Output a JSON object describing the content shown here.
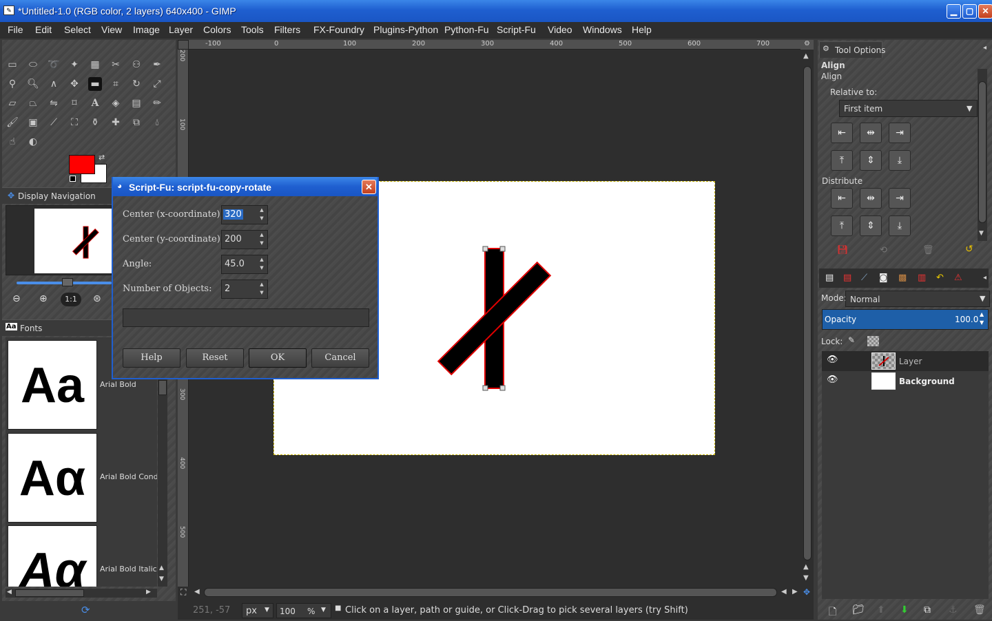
{
  "window": {
    "title": "*Untitled-1.0 (RGB color, 2 layers) 640x400 - GIMP",
    "min": "▁",
    "max": "▢",
    "close": "✕"
  },
  "menu": [
    "File",
    "Edit",
    "Select",
    "View",
    "Image",
    "Layer",
    "Colors",
    "Tools",
    "Filters",
    "FX-Foundry",
    "Plugins-Python",
    "Python-Fu",
    "Script-Fu",
    "Video",
    "Windows",
    "Help"
  ],
  "colors": {
    "fg": "#ff0000",
    "bg": "#ffffff",
    "accent": "#1f5fd0",
    "opacity_bar": "#1e5fa8"
  },
  "navigation": {
    "title": "Display Navigation"
  },
  "fonts": {
    "title": "Fonts",
    "items": [
      {
        "preview": "Aa",
        "name": "Arial Bold"
      },
      {
        "preview": "Aα",
        "name": "Arial Bold Conde"
      },
      {
        "preview": "Aα",
        "name": "Arial Bold Italic"
      }
    ]
  },
  "ruler_top": [
    "-100",
    "0",
    "100",
    "200",
    "300",
    "400",
    "500",
    "600",
    "700"
  ],
  "ruler_left": [
    "200",
    "100",
    "0",
    "100",
    "200",
    "300",
    "400",
    "500"
  ],
  "dialog": {
    "title": "Script-Fu: script-fu-copy-rotate",
    "fields": [
      {
        "label": "Center (x-coordinate):",
        "value": "320"
      },
      {
        "label": "Center (y-coordinate):",
        "value": "200"
      },
      {
        "label": "Angle:",
        "value": "45.0"
      },
      {
        "label": "Number of Objects:",
        "value": "2"
      }
    ],
    "buttons": {
      "help": "Help",
      "reset": "Reset",
      "ok": "OK",
      "cancel": "Cancel"
    }
  },
  "tool_options": {
    "tab": "Tool Options",
    "heading": "Align",
    "subheading": "Align",
    "relative_label": "Relative to:",
    "relative_value": "First item",
    "distribute_label": "Distribute"
  },
  "layers": {
    "mode_label": "Mode:",
    "mode_value": "Normal",
    "opacity_label": "Opacity",
    "opacity_value": "100.0",
    "opacity_level": 1.0,
    "lock_label": "Lock:",
    "items": [
      {
        "name": "Layer",
        "bold": false
      },
      {
        "name": "Background",
        "bold": true
      }
    ]
  },
  "status": {
    "coords": "251, -57",
    "unit": "px",
    "zoom": "100",
    "zoom_unit": "%",
    "message": "Click on a layer, path or guide, or Click-Drag to pick several layers (try Shift)"
  }
}
